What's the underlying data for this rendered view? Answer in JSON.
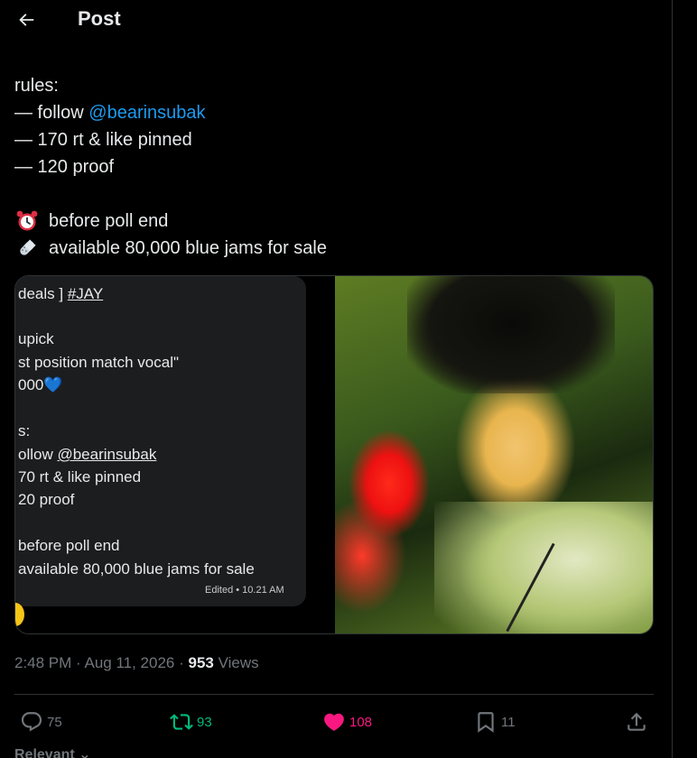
{
  "header": {
    "title": "Post",
    "back_icon": "arrow-left-icon"
  },
  "post": {
    "lines": {
      "rules_label": "rules:",
      "rule1_prefix": "— follow",
      "rule1_mention": "@bearinsubak",
      "rule2": "— 170 rt & like pinned",
      "rule3": "— 120 proof",
      "note1": "before poll end",
      "note2": "available 80,000 blue jams for sale"
    },
    "note1_icon": "alarm-clock-icon",
    "note2_icon": "pill-icon"
  },
  "media": {
    "screenshot": {
      "line1_a": "deals ] ",
      "line1_b": "#JAY",
      "line2": "upick",
      "line3": "st position match vocal\"",
      "line4": "000💙",
      "line5": "s:",
      "line6_a": "ollow ",
      "line6_b": "@bearinsubak",
      "line7": "70 rt & like pinned",
      "line8": "20 proof",
      "line9": "before poll end",
      "line10": "available 80,000 blue jams for sale",
      "edited": "Edited • 10.21 AM"
    }
  },
  "meta": {
    "time": "2:48 PM",
    "sep1": " · ",
    "date": "Aug 11, 2026",
    "sep2": " · ",
    "views_count": "953",
    "views_label": " Views"
  },
  "actions": {
    "replies": "75",
    "reposts": "93",
    "likes": "108",
    "bookmarks": "11"
  },
  "colors": {
    "accent": "#1d9bf0",
    "repost": "#00ba7c",
    "like": "#f91880",
    "muted": "#71767b"
  },
  "footer": {
    "sort_label": "Relevant"
  }
}
